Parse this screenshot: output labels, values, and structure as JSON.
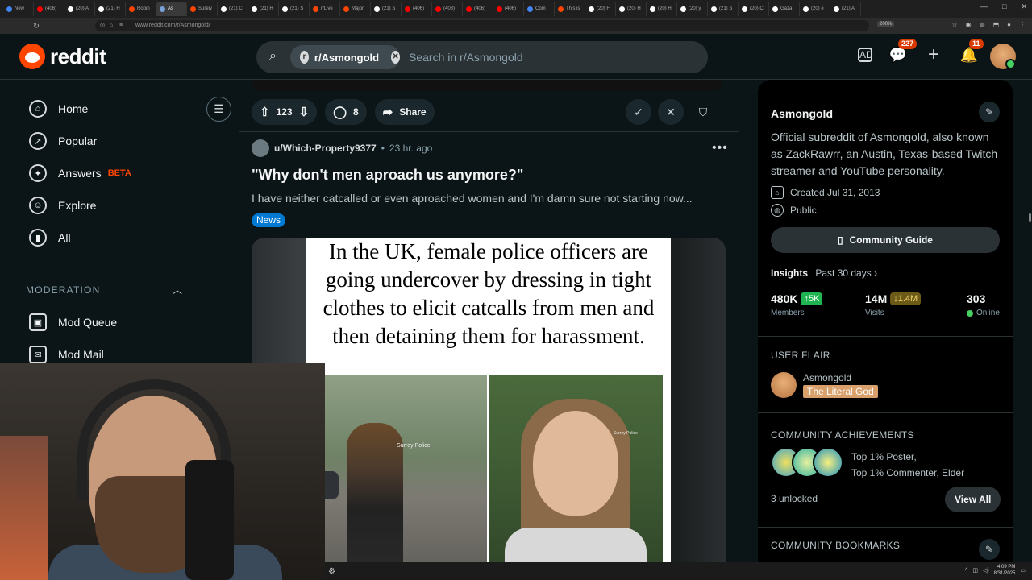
{
  "browser": {
    "tabs": [
      {
        "label": "New",
        "color": "#4285f4"
      },
      {
        "label": "(406)",
        "color": "#ff0000"
      },
      {
        "label": "(20) A",
        "color": "#ffffff"
      },
      {
        "label": "(21) H",
        "color": "#ffffff"
      },
      {
        "label": "Robin",
        "color": "#ff4500"
      },
      {
        "label": "As",
        "color": "#7aa0d8"
      },
      {
        "label": "Surely",
        "color": "#ff4500"
      },
      {
        "label": "(21) C",
        "color": "#ffffff"
      },
      {
        "label": "(21) H",
        "color": "#ffffff"
      },
      {
        "label": "(21) S",
        "color": "#ffffff"
      },
      {
        "label": "r/Live",
        "color": "#ff4500"
      },
      {
        "label": "Major",
        "color": "#ff4500"
      },
      {
        "label": "(21) S",
        "color": "#ffffff"
      },
      {
        "label": "(406)",
        "color": "#ff0000"
      },
      {
        "label": "(408)",
        "color": "#ff0000"
      },
      {
        "label": "(406)",
        "color": "#ff0000"
      },
      {
        "label": "(406)",
        "color": "#ff0000"
      },
      {
        "label": "Com",
        "color": "#4285f4"
      },
      {
        "label": "This is",
        "color": "#ff4500"
      },
      {
        "label": "(20) F",
        "color": "#ffffff"
      },
      {
        "label": "(20) H",
        "color": "#ffffff"
      },
      {
        "label": "(20) H",
        "color": "#ffffff"
      },
      {
        "label": "(20) y",
        "color": "#ffffff"
      },
      {
        "label": "(21) S",
        "color": "#ffffff"
      },
      {
        "label": "(20) C",
        "color": "#ffffff"
      },
      {
        "label": "Gaza",
        "color": "#ffffff"
      },
      {
        "label": "(20) e",
        "color": "#ffffff"
      },
      {
        "label": "(21) A",
        "color": "#ffffff"
      }
    ],
    "url": "www.reddit.com/r/Asmongold/",
    "zoom": "200%"
  },
  "header": {
    "logo_text": "reddit",
    "search_chip": "r/Asmongold",
    "search_placeholder": "Search in r/Asmongold",
    "chat_badge": "227",
    "notif_badge": "11"
  },
  "leftnav": {
    "items": [
      {
        "label": "Home",
        "icon": "home-icon",
        "glyph": "⌂"
      },
      {
        "label": "Popular",
        "icon": "popular-icon",
        "glyph": "↗"
      },
      {
        "label": "Answers",
        "icon": "answers-icon",
        "glyph": "✦"
      },
      {
        "label": "Explore",
        "icon": "explore-icon",
        "glyph": "☺"
      },
      {
        "label": "All",
        "icon": "all-icon",
        "glyph": "▮"
      }
    ],
    "beta_label": "BETA",
    "moderation_heading": "MODERATION",
    "mod_items": [
      {
        "label": "Mod Queue",
        "glyph": "▣"
      },
      {
        "label": "Mod Mail",
        "glyph": "✉"
      }
    ]
  },
  "feed": {
    "actions": {
      "upvotes": "123",
      "comments": "8",
      "share": "Share"
    },
    "post": {
      "author": "u/Which-Property9377",
      "sep": "•",
      "time": "23 hr. ago",
      "title": "\"Why don't men aproach us anymore?\"",
      "body": "I have neither catcalled or even aproached women and I'm damn sure not starting now...",
      "flair": "News",
      "image_text": "In the UK, female police officers are going undercover by dressing in tight clothes to elicit catcalls from men and then detaining them for harassment.",
      "watermark_1": "Surrey Police",
      "watermark_2": "Surrey Police"
    }
  },
  "sidebar": {
    "community_name": "Asmongold",
    "description": "Official subreddit of Asmongold, also known as ZackRawrr, an Austin, Texas-based Twitch streamer and YouTube personality.",
    "created": "Created Jul 31, 2013",
    "visibility": "Public",
    "guide_button": "Community Guide",
    "insights_label": "Insights",
    "insights_period": "Past 30 days ›",
    "stats": {
      "members_value": "480K",
      "members_change": "↑5K",
      "members_label": "Members",
      "visits_value": "14M",
      "visits_change": "↓1.4M",
      "visits_label": "Visits",
      "online_value": "303",
      "online_label": "Online"
    },
    "user_flair_heading": "USER FLAIR",
    "flair_user": "Asmongold",
    "flair_tag": "The Literal God",
    "achievements_heading": "COMMUNITY ACHIEVEMENTS",
    "achievements_line1": "Top 1% Poster,",
    "achievements_line2": "Top 1% Commenter, Elder",
    "unlocked": "3 unlocked",
    "view_all": "View All",
    "bookmarks_heading": "COMMUNITY BOOKMARKS"
  },
  "taskbar": {
    "time": "4:09 PM",
    "date": "8/31/2025"
  },
  "colors": {
    "brand": "#ff4500",
    "flair_blue": "#0079d3",
    "members_up": "#1fb550",
    "visits_down": "#6b5a18"
  }
}
